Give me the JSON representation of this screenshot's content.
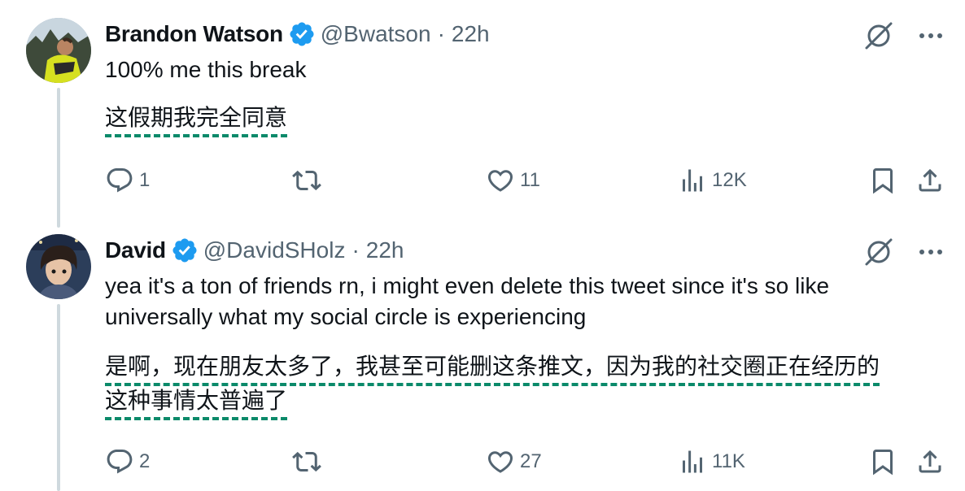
{
  "tweets": [
    {
      "name": "Brandon Watson",
      "handle": "@Bwatson",
      "separator": "·",
      "time": "22h",
      "text_en": "100% me this break",
      "text_zh_lines": [
        "这假期我完全同意"
      ],
      "replies": "1",
      "retweets": "",
      "likes": "11",
      "views": "12K"
    },
    {
      "name": "David",
      "handle": "@DavidSHolz",
      "separator": "·",
      "time": "22h",
      "text_en": "yea it's a ton of friends rn, i might even delete this tweet since it's so like universally what my social circle is experiencing",
      "text_zh_lines": [
        "是啊，现在朋友太多了，我甚至可能删这条推文，因为我的社交圈正在经历的",
        "这种事情太普遍了"
      ],
      "replies": "2",
      "retweets": "",
      "likes": "27",
      "views": "11K"
    }
  ],
  "colors": {
    "verified": "#1d9bf0",
    "secondary_text": "#536471",
    "translation_underline": "#0b8a6a",
    "thread_line": "#cfd9de"
  },
  "icons": [
    "verified-badge-icon",
    "grok-icon",
    "more-icon",
    "reply-icon",
    "retweet-icon",
    "like-icon",
    "views-icon",
    "bookmark-icon",
    "share-icon"
  ]
}
